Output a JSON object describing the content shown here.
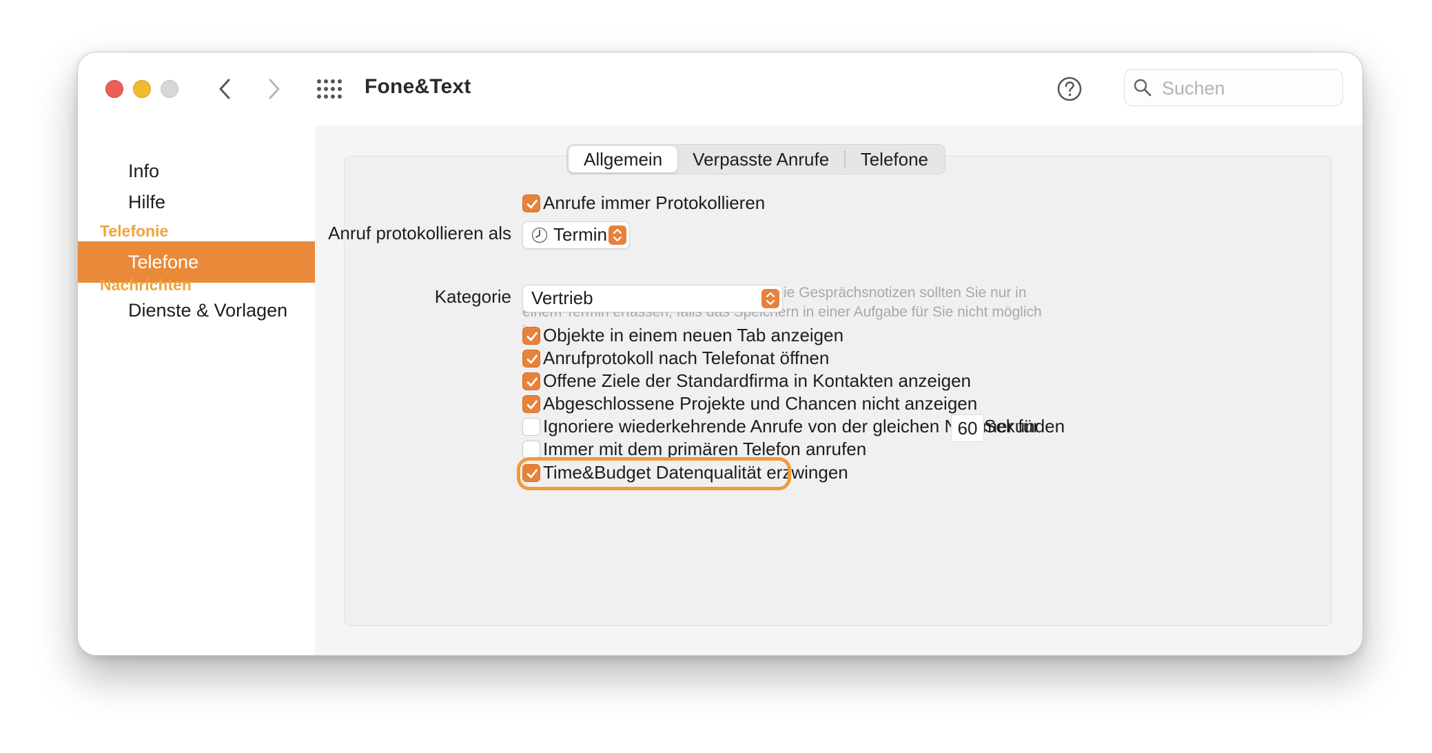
{
  "window": {
    "title": "Fone&Text",
    "search_placeholder": "Suchen"
  },
  "icons": {
    "close": "traffic-light-red",
    "minimize": "traffic-light-yellow",
    "zoom": "traffic-light-gray",
    "back": "chevron-left",
    "forward": "chevron-right",
    "grid": "dot-grid",
    "help": "question-mark-circle",
    "search": "magnifying-glass",
    "termin": "clock"
  },
  "colors": {
    "accent": "#e8813a",
    "section_header": "#f0a43c",
    "highlight_ring": "#f09a3a"
  },
  "sidebar": {
    "items": [
      {
        "label": "Info",
        "type": "item"
      },
      {
        "label": "Hilfe",
        "type": "item"
      },
      {
        "label": "Telefonie",
        "type": "header"
      },
      {
        "label": "Telefone",
        "type": "item",
        "active": true
      },
      {
        "label": "Nachrichten",
        "type": "header"
      },
      {
        "label": "Dienste & Vorlagen",
        "type": "item"
      }
    ]
  },
  "tabs": [
    {
      "label": "Allgemein",
      "selected": true
    },
    {
      "label": "Verpasste Anrufe",
      "selected": false
    },
    {
      "label": "Telefone",
      "selected": false
    }
  ],
  "general": {
    "log_always": {
      "label": "Anrufe immer Protokollieren",
      "checked": true
    },
    "log_as": {
      "label": "Anruf protokollieren als",
      "value": "Termin",
      "hint": "Anrufe werden als Termin gespeichert. Die Gesprächsnotizen sollten Sie nur in einem Termin erfassen, falls das Speichern in einer Aufgabe für Sie nicht möglich ist."
    },
    "category": {
      "label": "Kategorie",
      "value": "Vertrieb"
    },
    "options": [
      {
        "label": "Objekte in einem neuen Tab anzeigen",
        "checked": true
      },
      {
        "label": "Anrufprotokoll nach Telefonat öffnen",
        "checked": true
      },
      {
        "label": "Offene Ziele der Standardfirma in Kontakten anzeigen",
        "checked": true
      },
      {
        "label": "Abgeschlossene Projekte und Chancen nicht anzeigen",
        "checked": true
      },
      {
        "label": "Ignoriere wiederkehrende Anrufe von der gleichen Nummer für",
        "checked": false,
        "value": "60",
        "suffix": "Sekunden"
      },
      {
        "label": "Immer mit dem primären Telefon anrufen",
        "checked": false
      },
      {
        "label": "Time&Budget Datenqualität erzwingen",
        "checked": true,
        "highlighted": true
      }
    ]
  }
}
